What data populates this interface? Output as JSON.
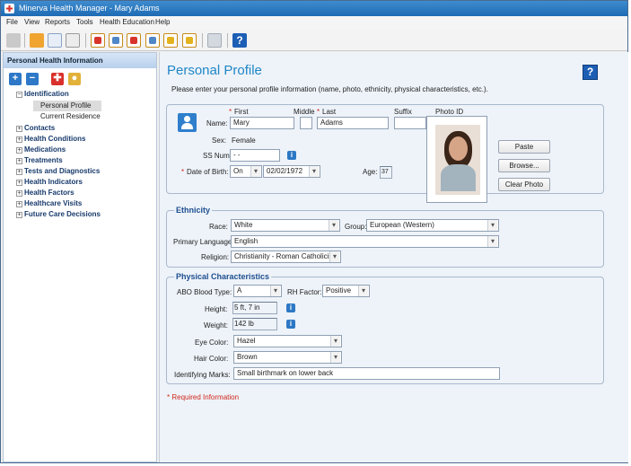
{
  "window": {
    "title": "Minerva Health Manager - Mary Adams"
  },
  "menubar": [
    "File",
    "View",
    "Reports",
    "Tools",
    "Health Education",
    "Help"
  ],
  "sidebar": {
    "title": "Personal Health Information",
    "tree": [
      {
        "label": "Identification",
        "expanded": true
      },
      {
        "label": "Personal Profile",
        "selected": true
      },
      {
        "label": "Current Residence"
      },
      {
        "label": "Contacts"
      },
      {
        "label": "Health Conditions"
      },
      {
        "label": "Medications"
      },
      {
        "label": "Treatments"
      },
      {
        "label": "Tests and Diagnostics"
      },
      {
        "label": "Health Indicators"
      },
      {
        "label": "Health Factors"
      },
      {
        "label": "Healthcare Visits"
      },
      {
        "label": "Future Care Decisions"
      }
    ]
  },
  "main": {
    "title": "Personal Profile",
    "intro": "Please enter your personal profile information (name, photo, ethnicity, physical characteristics, etc.).",
    "name": {
      "first_label": "First",
      "middle_label": "Middle",
      "last_label": "Last",
      "suffix_label": "Suffix",
      "row_label": "Name:",
      "first": "Mary",
      "middle": "",
      "last": "Adams",
      "suffix": ""
    },
    "sex_label": "Sex:",
    "sex": "Female",
    "ssn_label": "SS Number:",
    "ssn": "  -  -",
    "dob_label": "Date of Birth:",
    "dob_qualifier": "On",
    "dob": "02/02/1972",
    "age_label": "Age:",
    "age": "37",
    "photo": {
      "label": "Photo ID",
      "paste": "Paste",
      "browse": "Browse...",
      "clear": "Clear Photo"
    },
    "ethnicity": {
      "title": "Ethnicity",
      "race_label": "Race:",
      "race": "White",
      "group_label": "Group:",
      "group": "European (Western)",
      "language_label": "Primary Language:",
      "language": "English",
      "religion_label": "Religion:",
      "religion": "Christianity - Roman Catholicism"
    },
    "physical": {
      "title": "Physical Characteristics",
      "abo_label": "ABO Blood Type:",
      "abo": "A",
      "rh_label": "RH Factor:",
      "rh": "Positive",
      "height_label": "Height:",
      "height": "5 ft, 7 in",
      "weight_label": "Weight:",
      "weight": "142 lb",
      "eye_label": "Eye Color:",
      "eye": "Hazel",
      "hair_label": "Hair Color:",
      "hair": "Brown",
      "marks_label": "Identifying Marks:",
      "marks": "Small birthmark on lower back"
    },
    "required_note": "* Required Information"
  }
}
